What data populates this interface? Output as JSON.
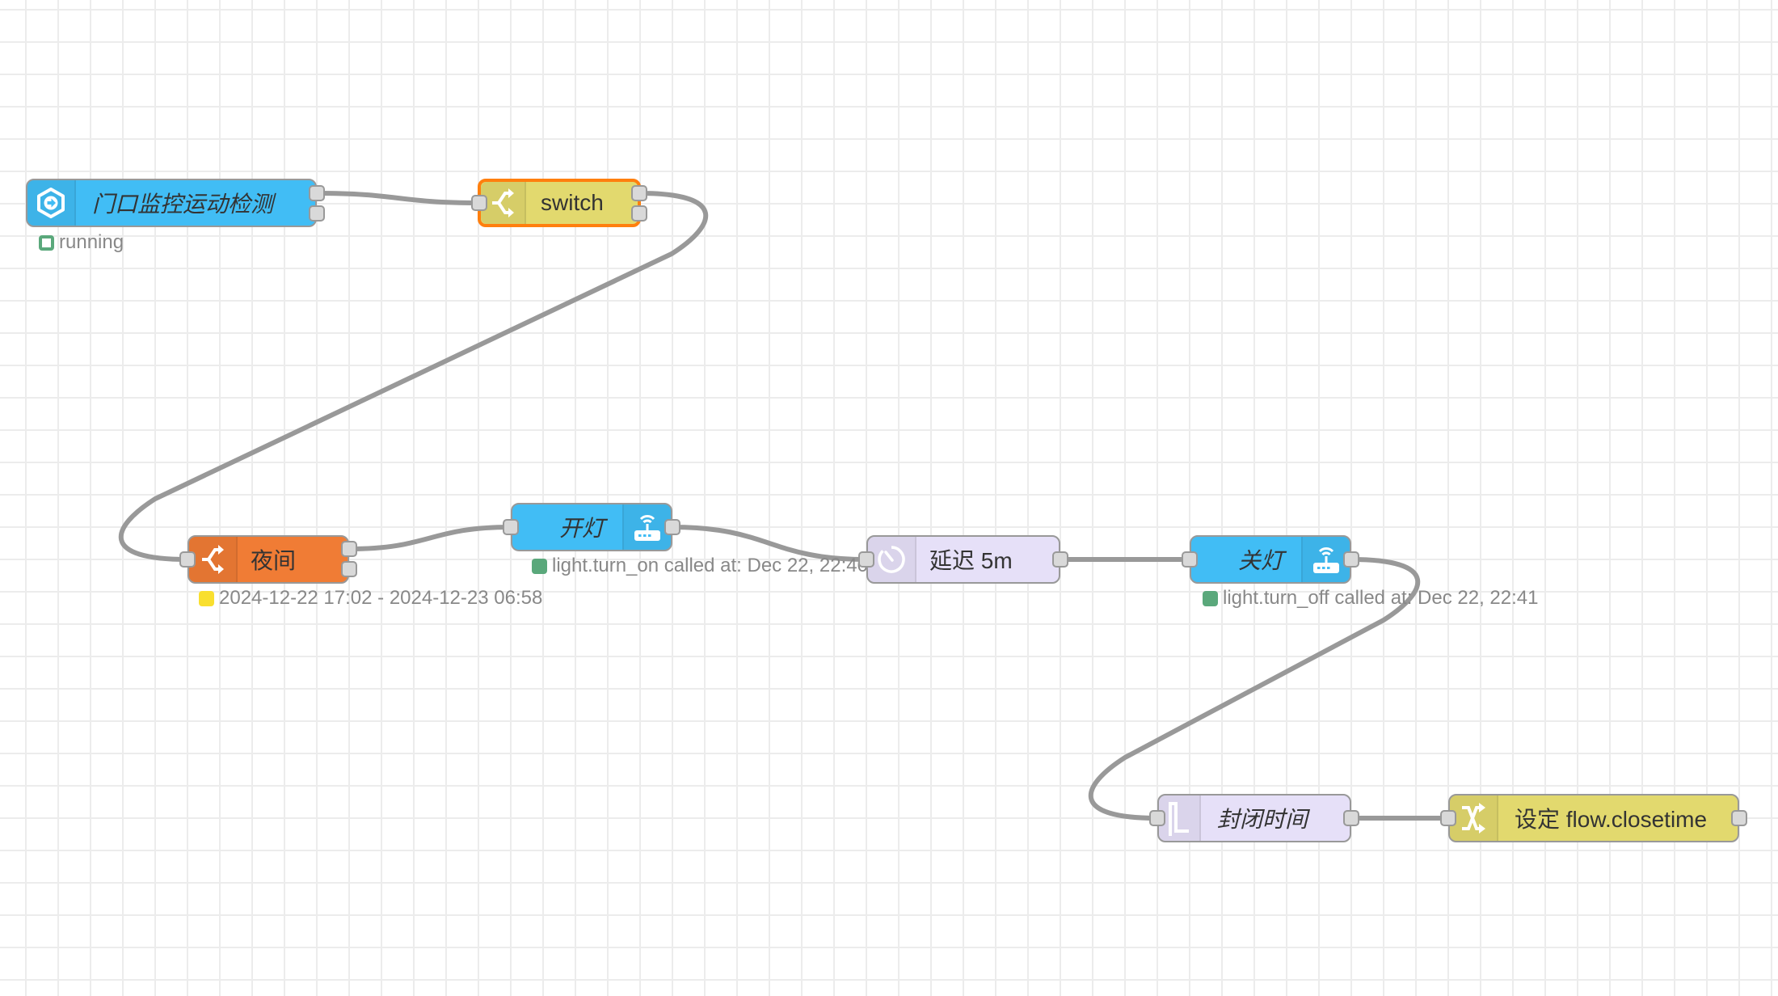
{
  "canvas": {
    "grid_color": "#ececec",
    "wire_color": "#999999"
  },
  "nodes": [
    {
      "id": "n1",
      "type": "events-state",
      "label": "门口监控运动检测",
      "italic": true,
      "color": "#41bdf5",
      "icon": "ha-server-events-icon",
      "outputs": 2,
      "inputs": 0,
      "status": {
        "text": "running",
        "color": "#5aa87b",
        "shape": "ring"
      }
    },
    {
      "id": "n2",
      "type": "switch",
      "label": "switch",
      "italic": false,
      "color": "#e2d96e",
      "icon": "switch-icon",
      "selected": true,
      "selected_color": "#ff7f0e",
      "inputs": 1,
      "outputs": 2
    },
    {
      "id": "n3",
      "type": "time-range-switch",
      "label": "夜间",
      "italic": false,
      "color": "#f07c35",
      "icon": "switch-icon",
      "inputs": 1,
      "outputs": 2,
      "status": {
        "text": "2024-12-22 17:02 - 2024-12-23 06:58",
        "color": "#f9df2f",
        "shape": "dot"
      }
    },
    {
      "id": "n4",
      "type": "api-call-service",
      "label": "开灯",
      "italic": true,
      "color": "#41bdf5",
      "icon": "router-wifi-icon",
      "inputs": 1,
      "outputs": 1,
      "status": {
        "text": "light.turn_on called at: Dec 22, 22:40",
        "color": "#5aa87b",
        "shape": "dot"
      }
    },
    {
      "id": "n5",
      "type": "delay",
      "label": "延迟 5m",
      "italic": false,
      "color": "#e6e0f8",
      "icon": "timer-icon",
      "inputs": 1,
      "outputs": 1
    },
    {
      "id": "n6",
      "type": "api-call-service",
      "label": "关灯",
      "italic": true,
      "color": "#41bdf5",
      "icon": "router-wifi-icon",
      "inputs": 1,
      "outputs": 1,
      "status": {
        "text": "light.turn_off called at: Dec 22, 22:41",
        "color": "#5aa87b",
        "shape": "dot"
      }
    },
    {
      "id": "n7",
      "type": "trigger",
      "label": "封闭时间",
      "italic": true,
      "color": "#e6e0f8",
      "icon": "trigger-pulse-icon",
      "inputs": 1,
      "outputs": 1
    },
    {
      "id": "n8",
      "type": "change",
      "label": "设定 flow.closetime",
      "italic": false,
      "color": "#e2d96e",
      "icon": "shuffle-icon",
      "inputs": 1,
      "outputs": 1
    }
  ],
  "wires": [
    {
      "from": "n1",
      "port": 0,
      "to": "n2"
    },
    {
      "from": "n2",
      "port": 0,
      "to": "n3"
    },
    {
      "from": "n3",
      "port": 0,
      "to": "n4"
    },
    {
      "from": "n4",
      "port": 0,
      "to": "n5"
    },
    {
      "from": "n5",
      "port": 0,
      "to": "n6"
    },
    {
      "from": "n6",
      "port": 0,
      "to": "n7"
    },
    {
      "from": "n7",
      "port": 0,
      "to": "n8"
    }
  ]
}
